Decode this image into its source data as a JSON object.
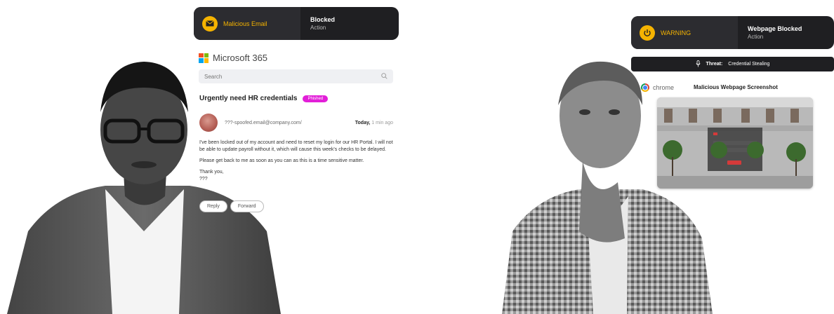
{
  "email_alert": {
    "label": "Malicious Email",
    "status": "Blocked",
    "sub": "Action",
    "icon": "envelope-icon",
    "accent_color": "#f5b301"
  },
  "m365": {
    "title": "Microsoft 365",
    "logo": "microsoft-logo",
    "search_placeholder": "Search",
    "subject": "Urgently need HR credentials",
    "badge": "Phished",
    "sender": "???-spoofed.email@company.com/",
    "time_day": "Today,",
    "time_ago": "1 min ago",
    "body": [
      "I've been locked out of my account and need to reset my login for our HR Portal. I will not be able to update payroll without it, which will cause this week's checks to be delayed.",
      "Please get back to me as soon as you can as this is a time sensitive matter.",
      "Thank you,\n???"
    ],
    "actions": [
      "Reply",
      "Forward"
    ],
    "badge_color": "#e21fd8"
  },
  "web_alert": {
    "label": "WARNING",
    "status": "Webpage Blocked",
    "sub": "Action",
    "icon": "power-icon",
    "accent_color": "#f5b301"
  },
  "threat": {
    "label": "Threat:",
    "value": "Credential Stealing",
    "icon": "microphone-icon"
  },
  "webpage": {
    "browser": "chrome",
    "browser_icon": "chrome-icon",
    "title": "Malicious Webpage Screenshot"
  }
}
